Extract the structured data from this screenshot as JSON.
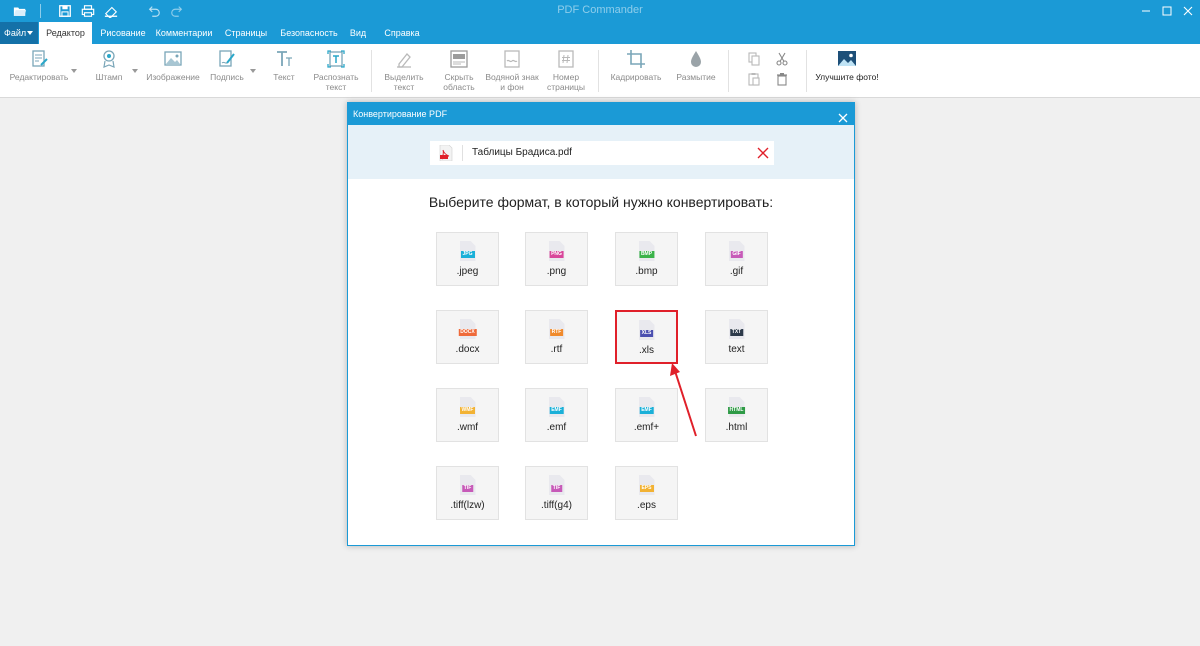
{
  "app": {
    "title": "PDF Commander"
  },
  "colors": {
    "accent": "#1b9ad6",
    "highlight": "#e0202a"
  },
  "menu": {
    "file": "Файл",
    "tabs": [
      "Редактор",
      "Рисование",
      "Комментарии",
      "Страницы",
      "Безопасность",
      "Вид",
      "Справка"
    ]
  },
  "ribbon": {
    "edit": "Редактировать",
    "stamp": "Штамп",
    "image": "Изображение",
    "signature": "Подпись",
    "text": "Текст",
    "ocr": "Распознать\nтекст",
    "select_text": "Выделить\nтекст",
    "hide_area": "Скрыть\nобласть",
    "watermark": "Водяной знак\nи фон",
    "page_number": "Номер\nстраницы",
    "crop": "Кадрировать",
    "blur": "Размытие",
    "improve_photo": "Улучшите фото!"
  },
  "dialog": {
    "title": "Конвертирование PDF",
    "file_name": "Таблицы Брадиса.pdf",
    "heading": "Выберите формат, в который нужно конвертировать:",
    "formats": [
      {
        "ext": ".jpeg",
        "badge": "JPG",
        "color": "#1ab0d8"
      },
      {
        "ext": ".png",
        "badge": "PNG",
        "color": "#d9469a"
      },
      {
        "ext": ".bmp",
        "badge": "BMP",
        "color": "#3bb34a"
      },
      {
        "ext": ".gif",
        "badge": "GIF",
        "color": "#c75ab8"
      },
      {
        "ext": ".docx",
        "badge": "DOCX",
        "color": "#ef6a3a"
      },
      {
        "ext": ".rtf",
        "badge": "RTF",
        "color": "#f08a2c"
      },
      {
        "ext": ".xls",
        "badge": "XLS",
        "color": "#4a4fb0"
      },
      {
        "ext": "text",
        "badge": "TXT",
        "color": "#2d3a4a"
      },
      {
        "ext": ".wmf",
        "badge": "WMF",
        "color": "#f2b233"
      },
      {
        "ext": ".emf",
        "badge": "EMF",
        "color": "#1ab0d8"
      },
      {
        "ext": ".emf+",
        "badge": "EMF",
        "color": "#1ab0d8"
      },
      {
        "ext": ".html",
        "badge": "HTML",
        "color": "#2e9a46"
      },
      {
        "ext": ".tiff(lzw)",
        "badge": "TIF",
        "color": "#c75ab8"
      },
      {
        "ext": ".tiff(g4)",
        "badge": "TIF",
        "color": "#c75ab8"
      },
      {
        "ext": ".eps",
        "badge": "EPS",
        "color": "#f2b233"
      }
    ],
    "selected": ".xls"
  }
}
